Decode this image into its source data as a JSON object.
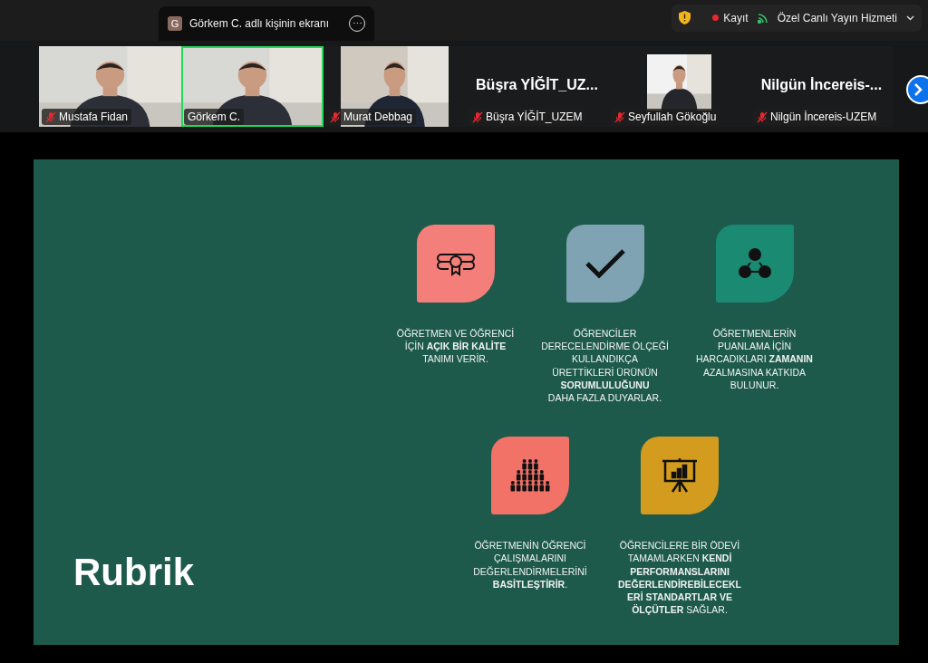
{
  "share_tab": {
    "avatar": "G",
    "title": "Görkem C. adlı kişinin ekranı",
    "more": "⋯"
  },
  "status": {
    "recording": "Kayıt",
    "stream": "Özel Canlı Yayın Hizmeti"
  },
  "participants": [
    {
      "kind": "video",
      "label": "Mustafa Fidan",
      "muted": true,
      "speaking": false
    },
    {
      "kind": "video",
      "label": "Görkem C.",
      "muted": false,
      "speaking": true
    },
    {
      "kind": "pillarbox",
      "label": "Murat Debbag",
      "muted": true,
      "speaking": false
    },
    {
      "kind": "name",
      "name": "Büşra YİĞİT_UZ...",
      "label": "Büşra YİĞİT_UZEM",
      "muted": true,
      "speaking": false
    },
    {
      "label": "Seyfullah Gökoğlu",
      "muted": true,
      "speaking": false
    },
    {
      "kind": "name",
      "name": "Nilgün İncereis-...",
      "label": "Nilgün İncereis-UZEM",
      "muted": true,
      "speaking": false
    }
  ],
  "slide": {
    "title": "Rubrik",
    "rows": [
      [
        {
          "color": "#f47f7a",
          "text": "ÖĞRETMEN VE ÖĞRENCİ\nİÇİN **AÇIK BİR KALİTE**\nTANIMI VERİR."
        },
        {
          "color": "#7fa3b3",
          "text": "ÖĞRENCİLER\nDERECELENDİRME ÖLÇEĞİ\nKULLANDIKÇA\nÜRETTİKLERİ ÜRÜNÜN\n**SORUMLULUĞUNU**\nDAHA FAZLA DUYARLAR."
        },
        {
          "color": "#1a8a72",
          "text": "ÖĞRETMENLERİN\nPUANLAMA İÇİN\nHARCADIKLARI **ZAMANIN**\nAZALMASINA KATKIDA\nBULUNUR."
        }
      ],
      [
        {
          "color": "#f27268",
          "text": "ÖĞRETMENİN ÖĞRENCİ\nÇALIŞMALARINI\nDEĞERLENDİRMELERİNİ\n**BASİTLEŞTİRİR**."
        },
        {
          "color": "#d49c1e",
          "text": "ÖĞRENCİLERE BİR ÖDEVİ\nTAMAMLARKEN **KENDİ**\n**PERFORMANSLARINI**\n**DEĞERLENDİREBİLECEKL**\n**ERİ STANDARTLAR VE**\n**ÖLÇÜTLER** SAĞLAR."
        }
      ]
    ]
  }
}
